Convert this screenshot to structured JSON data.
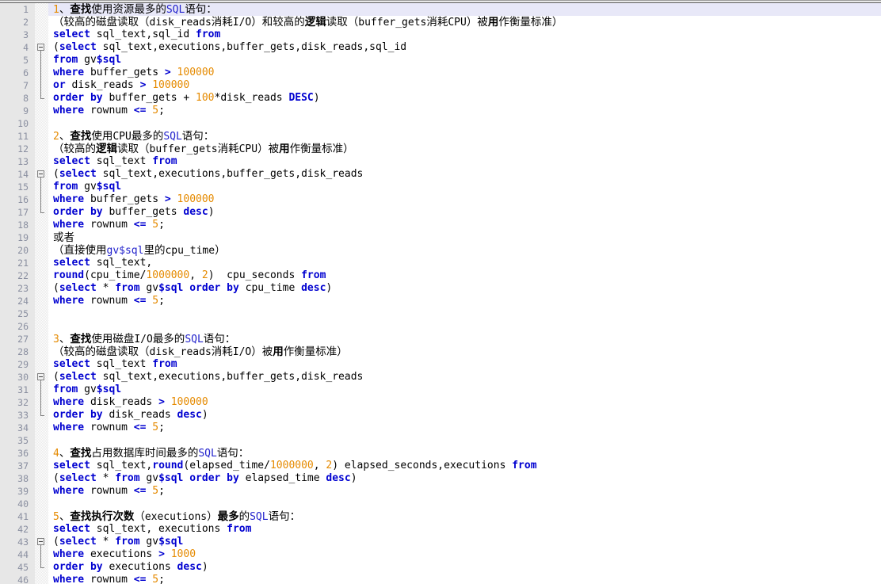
{
  "app": {
    "title": "SQL code editor",
    "type": "text-editor",
    "language": "sql",
    "total_visible_lines": 46,
    "current_line": 1,
    "colors": {
      "background": "#ffffff",
      "gutter": "#e7e7e7",
      "line_number": "#8a8fa0",
      "current_line_highlight": "#e8e8f8",
      "keyword": "#0000d0",
      "number": "#e58a00",
      "identifier": "#000000",
      "comment": "#000000",
      "fold_marker": "#808080"
    }
  },
  "lines": [
    {
      "n": 1,
      "current": true,
      "tokens": [
        {
          "t": "cmt-num",
          "v": "1"
        },
        {
          "t": "zh",
          "v": "、"
        },
        {
          "t": "zhb",
          "v": "查找"
        },
        {
          "t": "zh",
          "v": "使用资源最多的"
        },
        {
          "t": "cmt-kw",
          "v": "SQL"
        },
        {
          "t": "zh",
          "v": "语句："
        }
      ]
    },
    {
      "n": 2,
      "tokens": [
        {
          "t": "zh",
          "v": "（较高的磁盘读取（"
        },
        {
          "t": "cmt",
          "v": "disk_reads"
        },
        {
          "t": "zh",
          "v": "消耗"
        },
        {
          "t": "cmt",
          "v": "I/O"
        },
        {
          "t": "zh",
          "v": "）和较高的"
        },
        {
          "t": "zhb",
          "v": "逻辑"
        },
        {
          "t": "zh",
          "v": "读取（"
        },
        {
          "t": "cmt",
          "v": "buffer_gets"
        },
        {
          "t": "zh",
          "v": "消耗"
        },
        {
          "t": "cmt",
          "v": "CPU"
        },
        {
          "t": "zh",
          "v": "）被"
        },
        {
          "t": "zhb",
          "v": "用"
        },
        {
          "t": "zh",
          "v": "作衡量标准）"
        }
      ]
    },
    {
      "n": 3,
      "tokens": [
        {
          "t": "kw",
          "v": "select"
        },
        {
          "t": "idn",
          "v": " sql_text,sql_id "
        },
        {
          "t": "kw",
          "v": "from"
        }
      ]
    },
    {
      "n": 4,
      "fold": "start",
      "tokens": [
        {
          "t": "idn",
          "v": "("
        },
        {
          "t": "kw",
          "v": "select"
        },
        {
          "t": "idn",
          "v": " sql_text,executions,buffer_gets,disk_reads,sql_id"
        }
      ]
    },
    {
      "n": 5,
      "fold": "mid",
      "tokens": [
        {
          "t": "kw",
          "v": "from"
        },
        {
          "t": "idn",
          "v": " gv"
        },
        {
          "t": "kw",
          "v": "$sql"
        }
      ]
    },
    {
      "n": 6,
      "fold": "mid",
      "tokens": [
        {
          "t": "kw",
          "v": "where"
        },
        {
          "t": "idn",
          "v": " buffer_gets "
        },
        {
          "t": "kw",
          "v": ">"
        },
        {
          "t": "idn",
          "v": " "
        },
        {
          "t": "num",
          "v": "100000"
        }
      ]
    },
    {
      "n": 7,
      "fold": "mid",
      "tokens": [
        {
          "t": "kw",
          "v": "or"
        },
        {
          "t": "idn",
          "v": " disk_reads "
        },
        {
          "t": "kw",
          "v": ">"
        },
        {
          "t": "idn",
          "v": " "
        },
        {
          "t": "num",
          "v": "100000"
        }
      ]
    },
    {
      "n": 8,
      "fold": "end",
      "tokens": [
        {
          "t": "kw",
          "v": "order by"
        },
        {
          "t": "idn",
          "v": " buffer_gets + "
        },
        {
          "t": "num",
          "v": "100"
        },
        {
          "t": "idn",
          "v": "*disk_reads "
        },
        {
          "t": "kw",
          "v": "DESC"
        },
        {
          "t": "idn",
          "v": ")"
        }
      ]
    },
    {
      "n": 9,
      "tokens": [
        {
          "t": "kw",
          "v": "where"
        },
        {
          "t": "idn",
          "v": " rownum "
        },
        {
          "t": "kw",
          "v": "<="
        },
        {
          "t": "idn",
          "v": " "
        },
        {
          "t": "num",
          "v": "5"
        },
        {
          "t": "idn",
          "v": ";"
        }
      ]
    },
    {
      "n": 10,
      "tokens": []
    },
    {
      "n": 11,
      "tokens": [
        {
          "t": "cmt-num",
          "v": "2"
        },
        {
          "t": "zh",
          "v": "、"
        },
        {
          "t": "zhb",
          "v": "查找"
        },
        {
          "t": "zh",
          "v": "使用"
        },
        {
          "t": "cmt",
          "v": "CPU"
        },
        {
          "t": "zh",
          "v": "最多的"
        },
        {
          "t": "cmt-kw",
          "v": "SQL"
        },
        {
          "t": "zh",
          "v": "语句："
        }
      ]
    },
    {
      "n": 12,
      "tokens": [
        {
          "t": "zh",
          "v": "（较高的"
        },
        {
          "t": "zhb",
          "v": "逻辑"
        },
        {
          "t": "zh",
          "v": "读取（"
        },
        {
          "t": "cmt",
          "v": "buffer_gets"
        },
        {
          "t": "zh",
          "v": "消耗"
        },
        {
          "t": "cmt",
          "v": "CPU"
        },
        {
          "t": "zh",
          "v": "）被"
        },
        {
          "t": "zhb",
          "v": "用"
        },
        {
          "t": "zh",
          "v": "作衡量标准）"
        }
      ]
    },
    {
      "n": 13,
      "tokens": [
        {
          "t": "kw",
          "v": "select"
        },
        {
          "t": "idn",
          "v": " sql_text "
        },
        {
          "t": "kw",
          "v": "from"
        }
      ]
    },
    {
      "n": 14,
      "fold": "start",
      "tokens": [
        {
          "t": "idn",
          "v": "("
        },
        {
          "t": "kw",
          "v": "select"
        },
        {
          "t": "idn",
          "v": " sql_text,executions,buffer_gets,disk_reads"
        }
      ]
    },
    {
      "n": 15,
      "fold": "mid",
      "tokens": [
        {
          "t": "kw",
          "v": "from"
        },
        {
          "t": "idn",
          "v": " gv"
        },
        {
          "t": "kw",
          "v": "$sql"
        }
      ]
    },
    {
      "n": 16,
      "fold": "mid",
      "tokens": [
        {
          "t": "kw",
          "v": "where"
        },
        {
          "t": "idn",
          "v": " buffer_gets "
        },
        {
          "t": "kw",
          "v": ">"
        },
        {
          "t": "idn",
          "v": " "
        },
        {
          "t": "num",
          "v": "100000"
        }
      ]
    },
    {
      "n": 17,
      "fold": "end",
      "tokens": [
        {
          "t": "kw",
          "v": "order by"
        },
        {
          "t": "idn",
          "v": " buffer_gets "
        },
        {
          "t": "kw",
          "v": "desc"
        },
        {
          "t": "idn",
          "v": ")"
        }
      ]
    },
    {
      "n": 18,
      "tokens": [
        {
          "t": "kw",
          "v": "where"
        },
        {
          "t": "idn",
          "v": " rownum "
        },
        {
          "t": "kw",
          "v": "<="
        },
        {
          "t": "idn",
          "v": " "
        },
        {
          "t": "num",
          "v": "5"
        },
        {
          "t": "idn",
          "v": ";"
        }
      ]
    },
    {
      "n": 19,
      "tokens": [
        {
          "t": "zh",
          "v": "或者"
        }
      ]
    },
    {
      "n": 20,
      "tokens": [
        {
          "t": "zh",
          "v": "（直接使用"
        },
        {
          "t": "cmt-kw",
          "v": "gv$sql"
        },
        {
          "t": "zh",
          "v": "里的"
        },
        {
          "t": "cmt",
          "v": "cpu_time"
        },
        {
          "t": "zh",
          "v": "）"
        }
      ]
    },
    {
      "n": 21,
      "tokens": [
        {
          "t": "kw",
          "v": "select"
        },
        {
          "t": "idn",
          "v": " sql_text,"
        }
      ]
    },
    {
      "n": 22,
      "tokens": [
        {
          "t": "kw",
          "v": "round"
        },
        {
          "t": "idn",
          "v": "(cpu_time/"
        },
        {
          "t": "num",
          "v": "1000000"
        },
        {
          "t": "idn",
          "v": ", "
        },
        {
          "t": "num",
          "v": "2"
        },
        {
          "t": "idn",
          "v": ")  cpu_seconds "
        },
        {
          "t": "kw",
          "v": "from"
        }
      ]
    },
    {
      "n": 23,
      "tokens": [
        {
          "t": "idn",
          "v": "("
        },
        {
          "t": "kw",
          "v": "select"
        },
        {
          "t": "idn",
          "v": " * "
        },
        {
          "t": "kw",
          "v": "from"
        },
        {
          "t": "idn",
          "v": " gv"
        },
        {
          "t": "kw",
          "v": "$sql order by"
        },
        {
          "t": "idn",
          "v": " cpu_time "
        },
        {
          "t": "kw",
          "v": "desc"
        },
        {
          "t": "idn",
          "v": ")"
        }
      ]
    },
    {
      "n": 24,
      "tokens": [
        {
          "t": "kw",
          "v": "where"
        },
        {
          "t": "idn",
          "v": " rownum "
        },
        {
          "t": "kw",
          "v": "<="
        },
        {
          "t": "idn",
          "v": " "
        },
        {
          "t": "num",
          "v": "5"
        },
        {
          "t": "idn",
          "v": ";"
        }
      ]
    },
    {
      "n": 25,
      "tokens": []
    },
    {
      "n": 26,
      "tokens": []
    },
    {
      "n": 27,
      "tokens": [
        {
          "t": "cmt-num",
          "v": "3"
        },
        {
          "t": "zh",
          "v": "、"
        },
        {
          "t": "zhb",
          "v": "查找"
        },
        {
          "t": "zh",
          "v": "使用磁盘"
        },
        {
          "t": "cmt",
          "v": "I/O"
        },
        {
          "t": "zh",
          "v": "最多的"
        },
        {
          "t": "cmt-kw",
          "v": "SQL"
        },
        {
          "t": "zh",
          "v": "语句："
        }
      ]
    },
    {
      "n": 28,
      "tokens": [
        {
          "t": "zh",
          "v": "（较高的磁盘读取（"
        },
        {
          "t": "cmt",
          "v": "disk_reads"
        },
        {
          "t": "zh",
          "v": "消耗"
        },
        {
          "t": "cmt",
          "v": "I/O"
        },
        {
          "t": "zh",
          "v": "）被"
        },
        {
          "t": "zhb",
          "v": "用"
        },
        {
          "t": "zh",
          "v": "作衡量标准）"
        }
      ]
    },
    {
      "n": 29,
      "tokens": [
        {
          "t": "kw",
          "v": "select"
        },
        {
          "t": "idn",
          "v": " sql_text "
        },
        {
          "t": "kw",
          "v": "from"
        }
      ]
    },
    {
      "n": 30,
      "fold": "start",
      "tokens": [
        {
          "t": "idn",
          "v": "("
        },
        {
          "t": "kw",
          "v": "select"
        },
        {
          "t": "idn",
          "v": " sql_text,executions,buffer_gets,disk_reads"
        }
      ]
    },
    {
      "n": 31,
      "fold": "mid",
      "tokens": [
        {
          "t": "kw",
          "v": "from"
        },
        {
          "t": "idn",
          "v": " gv"
        },
        {
          "t": "kw",
          "v": "$sql"
        }
      ]
    },
    {
      "n": 32,
      "fold": "mid",
      "tokens": [
        {
          "t": "kw",
          "v": "where"
        },
        {
          "t": "idn",
          "v": " disk_reads "
        },
        {
          "t": "kw",
          "v": ">"
        },
        {
          "t": "idn",
          "v": " "
        },
        {
          "t": "num",
          "v": "100000"
        }
      ]
    },
    {
      "n": 33,
      "fold": "end",
      "tokens": [
        {
          "t": "kw",
          "v": "order by"
        },
        {
          "t": "idn",
          "v": " disk_reads "
        },
        {
          "t": "kw",
          "v": "desc"
        },
        {
          "t": "idn",
          "v": ")"
        }
      ]
    },
    {
      "n": 34,
      "tokens": [
        {
          "t": "kw",
          "v": "where"
        },
        {
          "t": "idn",
          "v": " rownum "
        },
        {
          "t": "kw",
          "v": "<="
        },
        {
          "t": "idn",
          "v": " "
        },
        {
          "t": "num",
          "v": "5"
        },
        {
          "t": "idn",
          "v": ";"
        }
      ]
    },
    {
      "n": 35,
      "tokens": []
    },
    {
      "n": 36,
      "tokens": [
        {
          "t": "cmt-num",
          "v": "4"
        },
        {
          "t": "zh",
          "v": "、"
        },
        {
          "t": "zhb",
          "v": "查找"
        },
        {
          "t": "zh",
          "v": "占用数据库时间最多的"
        },
        {
          "t": "cmt-kw",
          "v": "SQL"
        },
        {
          "t": "zh",
          "v": "语句："
        }
      ]
    },
    {
      "n": 37,
      "tokens": [
        {
          "t": "kw",
          "v": "select"
        },
        {
          "t": "idn",
          "v": " sql_text,"
        },
        {
          "t": "kw",
          "v": "round"
        },
        {
          "t": "idn",
          "v": "(elapsed_time/"
        },
        {
          "t": "num",
          "v": "1000000"
        },
        {
          "t": "idn",
          "v": ", "
        },
        {
          "t": "num",
          "v": "2"
        },
        {
          "t": "idn",
          "v": ") elapsed_seconds,executions "
        },
        {
          "t": "kw",
          "v": "from"
        }
      ]
    },
    {
      "n": 38,
      "tokens": [
        {
          "t": "idn",
          "v": "("
        },
        {
          "t": "kw",
          "v": "select"
        },
        {
          "t": "idn",
          "v": " * "
        },
        {
          "t": "kw",
          "v": "from"
        },
        {
          "t": "idn",
          "v": " gv"
        },
        {
          "t": "kw",
          "v": "$sql order by"
        },
        {
          "t": "idn",
          "v": " elapsed_time "
        },
        {
          "t": "kw",
          "v": "desc"
        },
        {
          "t": "idn",
          "v": ")"
        }
      ]
    },
    {
      "n": 39,
      "tokens": [
        {
          "t": "kw",
          "v": "where"
        },
        {
          "t": "idn",
          "v": " rownum "
        },
        {
          "t": "kw",
          "v": "<="
        },
        {
          "t": "idn",
          "v": " "
        },
        {
          "t": "num",
          "v": "5"
        },
        {
          "t": "idn",
          "v": ";"
        }
      ]
    },
    {
      "n": 40,
      "tokens": []
    },
    {
      "n": 41,
      "tokens": [
        {
          "t": "cmt-num",
          "v": "5"
        },
        {
          "t": "zh",
          "v": "、"
        },
        {
          "t": "zhb",
          "v": "查找执行次数"
        },
        {
          "t": "zh",
          "v": "（"
        },
        {
          "t": "cmt",
          "v": "executions"
        },
        {
          "t": "zh",
          "v": "）"
        },
        {
          "t": "zhb",
          "v": "最多"
        },
        {
          "t": "zh",
          "v": "的"
        },
        {
          "t": "cmt-kw",
          "v": "SQL"
        },
        {
          "t": "zh",
          "v": "语句："
        }
      ]
    },
    {
      "n": 42,
      "tokens": [
        {
          "t": "kw",
          "v": "select"
        },
        {
          "t": "idn",
          "v": " sql_text, executions "
        },
        {
          "t": "kw",
          "v": "from"
        }
      ]
    },
    {
      "n": 43,
      "fold": "start",
      "tokens": [
        {
          "t": "idn",
          "v": "("
        },
        {
          "t": "kw",
          "v": "select"
        },
        {
          "t": "idn",
          "v": " * "
        },
        {
          "t": "kw",
          "v": "from"
        },
        {
          "t": "idn",
          "v": " gv"
        },
        {
          "t": "kw",
          "v": "$sql"
        }
      ]
    },
    {
      "n": 44,
      "fold": "mid",
      "tokens": [
        {
          "t": "kw",
          "v": "where"
        },
        {
          "t": "idn",
          "v": " executions "
        },
        {
          "t": "kw",
          "v": ">"
        },
        {
          "t": "idn",
          "v": " "
        },
        {
          "t": "num",
          "v": "1000"
        }
      ]
    },
    {
      "n": 45,
      "fold": "end",
      "tokens": [
        {
          "t": "kw",
          "v": "order by"
        },
        {
          "t": "idn",
          "v": " executions "
        },
        {
          "t": "kw",
          "v": "desc"
        },
        {
          "t": "idn",
          "v": ")"
        }
      ]
    },
    {
      "n": 46,
      "clipped": true,
      "tokens": [
        {
          "t": "kw",
          "v": "where"
        },
        {
          "t": "idn",
          "v": " rownum "
        },
        {
          "t": "kw",
          "v": "<="
        },
        {
          "t": "idn",
          "v": " "
        },
        {
          "t": "num",
          "v": "5"
        },
        {
          "t": "idn",
          "v": ";"
        }
      ]
    }
  ]
}
